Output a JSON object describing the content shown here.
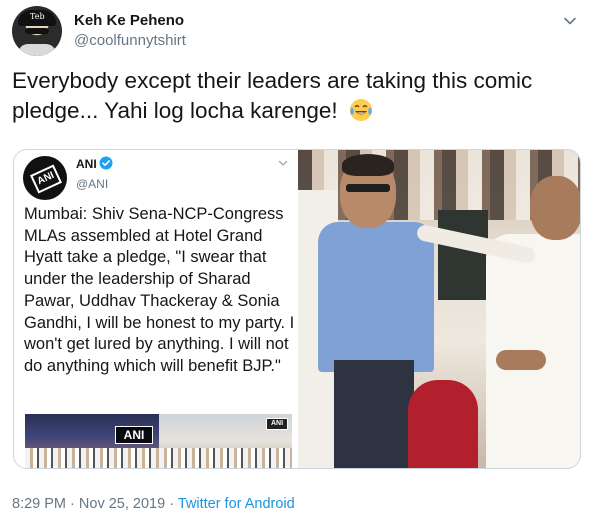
{
  "author": {
    "name": "Keh Ke Peheno",
    "handle": "@coolfunnytshirt",
    "avatar_cap_text": "Teb"
  },
  "tweet": {
    "text": "Everybody except their leaders are taking this comic pledge... Yahi log locha karenge!",
    "emoji": "face-with-tears-of-joy"
  },
  "quoted": {
    "name": "ANI",
    "handle": "@ANI",
    "verified": true,
    "text": "Mumbai: Shiv Sena-NCP-Congress MLAs assembled at Hotel Grand Hyatt take a pledge, \"I swear that under the leadership of Sharad Pawar, Uddhav Thackeray & Sonia Gandhi, I will be honest to my party. I won't get lured by anything. I will not do anything which will benefit BJP.\"",
    "thumb1_badge": "ANI",
    "thumb2_badge": "ANI",
    "logo_text": "ANI"
  },
  "footer": {
    "time": "8:29 PM",
    "separator": "·",
    "date": "Nov 25, 2019",
    "source": "Twitter for Android"
  },
  "colors": {
    "text": "#14171a",
    "muted": "#657786",
    "link": "#1b95e0",
    "border": "#ccd6dd",
    "verified": "#1da1f2"
  },
  "icons": {
    "menu": "chevron-down-icon",
    "verified": "verified-badge-icon"
  }
}
